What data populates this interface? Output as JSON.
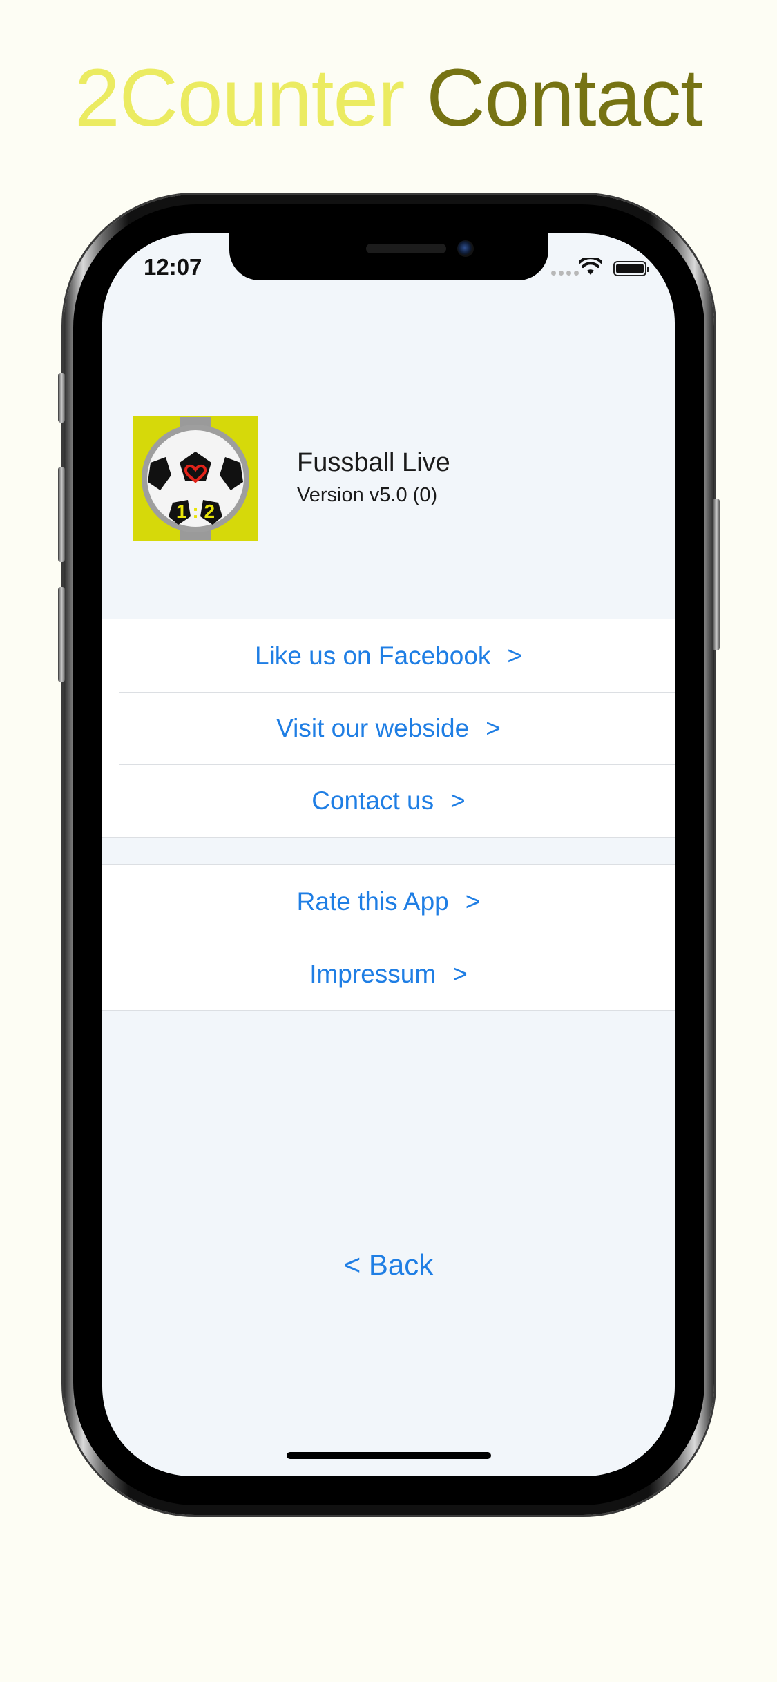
{
  "headline": {
    "word1": "2Counter",
    "word2": "Contact"
  },
  "status_bar": {
    "time": "12:07"
  },
  "app": {
    "name": "Fussball Live",
    "version": "Version v5.0 (0)",
    "icon_score": "1 : 2"
  },
  "links_group_1": [
    {
      "label": "Like us on Facebook",
      "chevron": ">"
    },
    {
      "label": "Visit our webside",
      "chevron": ">"
    },
    {
      "label": "Contact us",
      "chevron": ">"
    }
  ],
  "links_group_2": [
    {
      "label": "Rate this App",
      "chevron": ">"
    },
    {
      "label": "Impressum",
      "chevron": ">"
    }
  ],
  "back": {
    "label": "< Back"
  },
  "colors": {
    "background": "#fdfdf4",
    "headline_light": "#ebeb61",
    "headline_dark": "#767313",
    "link_blue": "#1f7ee4",
    "icon_yellow": "#d6d90a"
  }
}
